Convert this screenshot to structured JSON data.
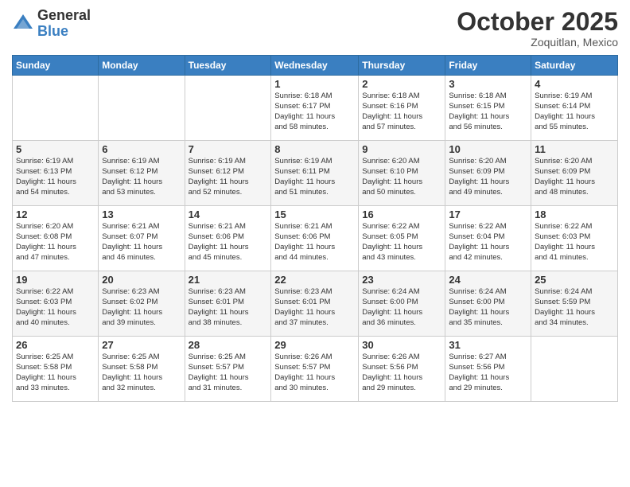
{
  "header": {
    "logo_general": "General",
    "logo_blue": "Blue",
    "month_title": "October 2025",
    "subtitle": "Zoquitlan, Mexico"
  },
  "days_of_week": [
    "Sunday",
    "Monday",
    "Tuesday",
    "Wednesday",
    "Thursday",
    "Friday",
    "Saturday"
  ],
  "weeks": [
    [
      {
        "day": "",
        "info": ""
      },
      {
        "day": "",
        "info": ""
      },
      {
        "day": "",
        "info": ""
      },
      {
        "day": "1",
        "info": "Sunrise: 6:18 AM\nSunset: 6:17 PM\nDaylight: 11 hours\nand 58 minutes."
      },
      {
        "day": "2",
        "info": "Sunrise: 6:18 AM\nSunset: 6:16 PM\nDaylight: 11 hours\nand 57 minutes."
      },
      {
        "day": "3",
        "info": "Sunrise: 6:18 AM\nSunset: 6:15 PM\nDaylight: 11 hours\nand 56 minutes."
      },
      {
        "day": "4",
        "info": "Sunrise: 6:19 AM\nSunset: 6:14 PM\nDaylight: 11 hours\nand 55 minutes."
      }
    ],
    [
      {
        "day": "5",
        "info": "Sunrise: 6:19 AM\nSunset: 6:13 PM\nDaylight: 11 hours\nand 54 minutes."
      },
      {
        "day": "6",
        "info": "Sunrise: 6:19 AM\nSunset: 6:12 PM\nDaylight: 11 hours\nand 53 minutes."
      },
      {
        "day": "7",
        "info": "Sunrise: 6:19 AM\nSunset: 6:12 PM\nDaylight: 11 hours\nand 52 minutes."
      },
      {
        "day": "8",
        "info": "Sunrise: 6:19 AM\nSunset: 6:11 PM\nDaylight: 11 hours\nand 51 minutes."
      },
      {
        "day": "9",
        "info": "Sunrise: 6:20 AM\nSunset: 6:10 PM\nDaylight: 11 hours\nand 50 minutes."
      },
      {
        "day": "10",
        "info": "Sunrise: 6:20 AM\nSunset: 6:09 PM\nDaylight: 11 hours\nand 49 minutes."
      },
      {
        "day": "11",
        "info": "Sunrise: 6:20 AM\nSunset: 6:09 PM\nDaylight: 11 hours\nand 48 minutes."
      }
    ],
    [
      {
        "day": "12",
        "info": "Sunrise: 6:20 AM\nSunset: 6:08 PM\nDaylight: 11 hours\nand 47 minutes."
      },
      {
        "day": "13",
        "info": "Sunrise: 6:21 AM\nSunset: 6:07 PM\nDaylight: 11 hours\nand 46 minutes."
      },
      {
        "day": "14",
        "info": "Sunrise: 6:21 AM\nSunset: 6:06 PM\nDaylight: 11 hours\nand 45 minutes."
      },
      {
        "day": "15",
        "info": "Sunrise: 6:21 AM\nSunset: 6:06 PM\nDaylight: 11 hours\nand 44 minutes."
      },
      {
        "day": "16",
        "info": "Sunrise: 6:22 AM\nSunset: 6:05 PM\nDaylight: 11 hours\nand 43 minutes."
      },
      {
        "day": "17",
        "info": "Sunrise: 6:22 AM\nSunset: 6:04 PM\nDaylight: 11 hours\nand 42 minutes."
      },
      {
        "day": "18",
        "info": "Sunrise: 6:22 AM\nSunset: 6:03 PM\nDaylight: 11 hours\nand 41 minutes."
      }
    ],
    [
      {
        "day": "19",
        "info": "Sunrise: 6:22 AM\nSunset: 6:03 PM\nDaylight: 11 hours\nand 40 minutes."
      },
      {
        "day": "20",
        "info": "Sunrise: 6:23 AM\nSunset: 6:02 PM\nDaylight: 11 hours\nand 39 minutes."
      },
      {
        "day": "21",
        "info": "Sunrise: 6:23 AM\nSunset: 6:01 PM\nDaylight: 11 hours\nand 38 minutes."
      },
      {
        "day": "22",
        "info": "Sunrise: 6:23 AM\nSunset: 6:01 PM\nDaylight: 11 hours\nand 37 minutes."
      },
      {
        "day": "23",
        "info": "Sunrise: 6:24 AM\nSunset: 6:00 PM\nDaylight: 11 hours\nand 36 minutes."
      },
      {
        "day": "24",
        "info": "Sunrise: 6:24 AM\nSunset: 6:00 PM\nDaylight: 11 hours\nand 35 minutes."
      },
      {
        "day": "25",
        "info": "Sunrise: 6:24 AM\nSunset: 5:59 PM\nDaylight: 11 hours\nand 34 minutes."
      }
    ],
    [
      {
        "day": "26",
        "info": "Sunrise: 6:25 AM\nSunset: 5:58 PM\nDaylight: 11 hours\nand 33 minutes."
      },
      {
        "day": "27",
        "info": "Sunrise: 6:25 AM\nSunset: 5:58 PM\nDaylight: 11 hours\nand 32 minutes."
      },
      {
        "day": "28",
        "info": "Sunrise: 6:25 AM\nSunset: 5:57 PM\nDaylight: 11 hours\nand 31 minutes."
      },
      {
        "day": "29",
        "info": "Sunrise: 6:26 AM\nSunset: 5:57 PM\nDaylight: 11 hours\nand 30 minutes."
      },
      {
        "day": "30",
        "info": "Sunrise: 6:26 AM\nSunset: 5:56 PM\nDaylight: 11 hours\nand 29 minutes."
      },
      {
        "day": "31",
        "info": "Sunrise: 6:27 AM\nSunset: 5:56 PM\nDaylight: 11 hours\nand 29 minutes."
      },
      {
        "day": "",
        "info": ""
      }
    ]
  ]
}
